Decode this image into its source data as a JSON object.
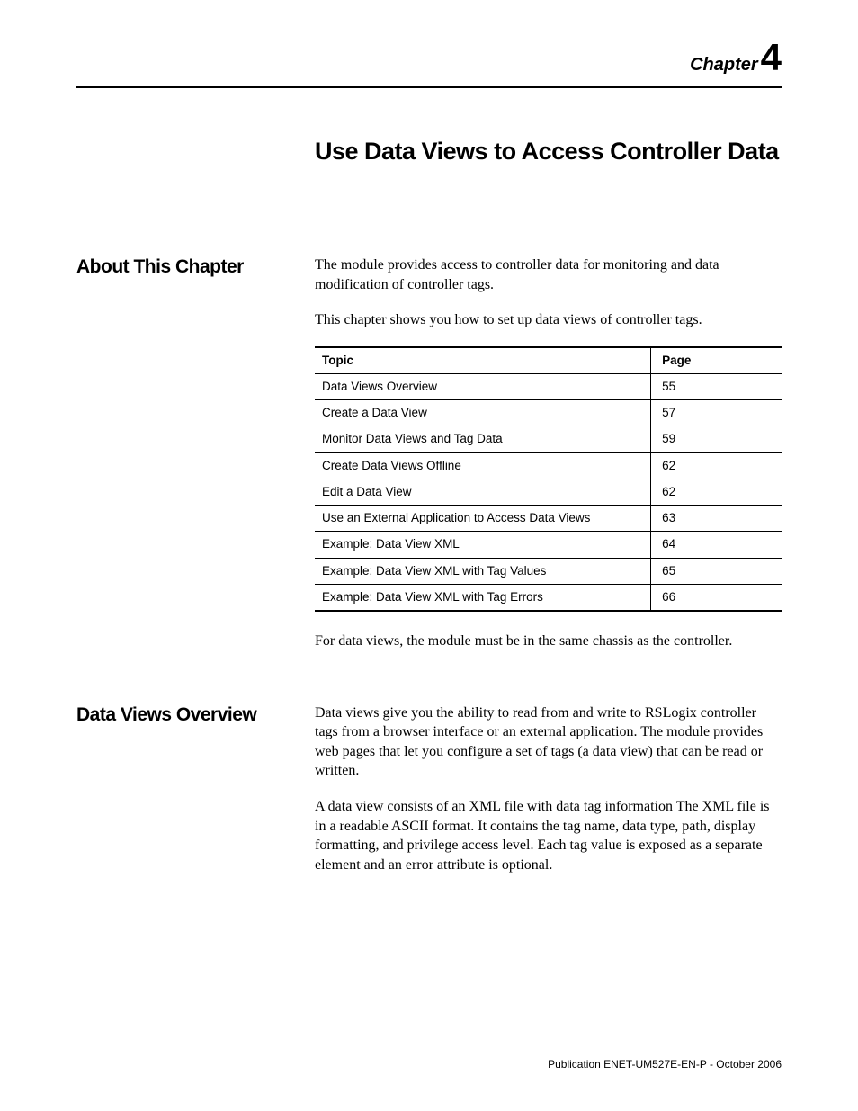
{
  "chapter": {
    "label": "Chapter",
    "number": "4",
    "title": "Use Data Views to Access Controller Data"
  },
  "about": {
    "heading": "About This Chapter",
    "para1": "The module provides access to controller data for monitoring and data modification of controller tags.",
    "para2": "This chapter shows you how to set up data views of controller tags.",
    "para3": "For data views, the module must be in the same chassis as the controller."
  },
  "table": {
    "header_topic": "Topic",
    "header_page": "Page",
    "rows": [
      {
        "topic": "Data Views Overview",
        "page": "55"
      },
      {
        "topic": "Create a Data View",
        "page": "57"
      },
      {
        "topic": "Monitor Data Views and Tag Data",
        "page": "59"
      },
      {
        "topic": "Create Data Views Offline",
        "page": "62"
      },
      {
        "topic": "Edit a Data View",
        "page": "62"
      },
      {
        "topic": "Use an External Application to Access Data Views",
        "page": "63"
      },
      {
        "topic": "Example: Data View XML",
        "page": "64"
      },
      {
        "topic": "Example: Data View XML with Tag Values",
        "page": "65"
      },
      {
        "topic": "Example: Data View XML with Tag Errors",
        "page": "66"
      }
    ]
  },
  "overview": {
    "heading": "Data Views Overview",
    "para1": "Data views give you the ability to read from and write to RSLogix controller tags from a browser interface or an external application. The module provides web pages that let you configure a set of tags (a data view) that can be read or written.",
    "para2": "A data view consists of an XML file with data tag information The XML file is in a readable ASCII format. It contains the tag name, data type, path, display formatting, and privilege access level. Each tag value is exposed as a separate element and an error attribute is optional."
  },
  "footer": "Publication ENET-UM527E-EN-P - October 2006"
}
